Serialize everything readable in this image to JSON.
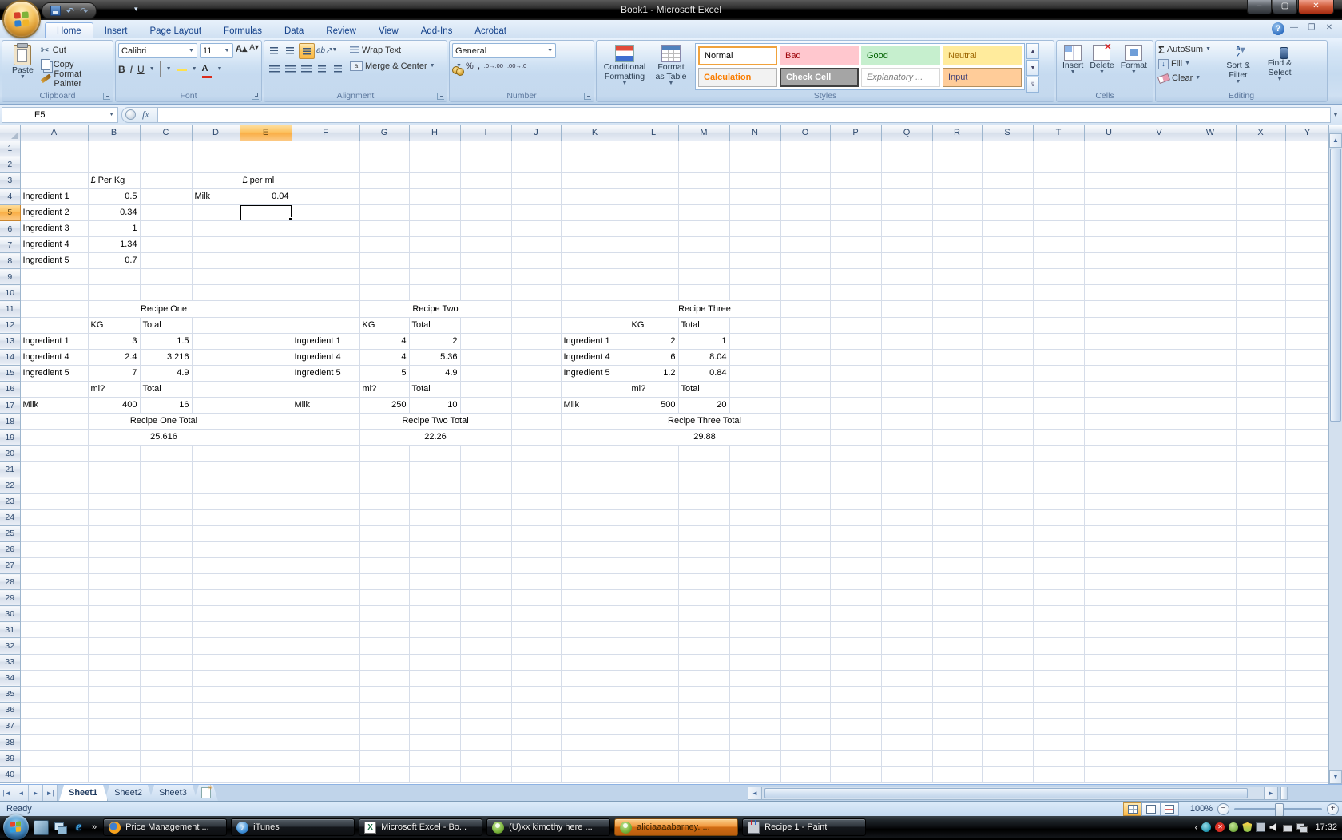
{
  "window": {
    "title": "Book1 - Microsoft Excel"
  },
  "ribbon": {
    "tabs": [
      {
        "label": "Home",
        "active": true
      },
      {
        "label": "Insert"
      },
      {
        "label": "Page Layout"
      },
      {
        "label": "Formulas"
      },
      {
        "label": "Data"
      },
      {
        "label": "Review"
      },
      {
        "label": "View"
      },
      {
        "label": "Add-Ins"
      },
      {
        "label": "Acrobat"
      }
    ],
    "clipboard": {
      "label": "Clipboard",
      "paste": "Paste",
      "cut": "Cut",
      "copy": "Copy",
      "format_painter": "Format Painter"
    },
    "font": {
      "label": "Font",
      "family": "Calibri",
      "size": "11",
      "bold": "B",
      "italic": "I",
      "underline": "U",
      "fontcolor": "A"
    },
    "alignment": {
      "label": "Alignment",
      "wrap_text": "Wrap Text",
      "merge_center": "Merge & Center"
    },
    "number": {
      "label": "Number",
      "format": "General",
      "percent": "%",
      "comma": ",",
      "inc_dec": ".0→.00",
      "dec_dec": ".00→.0"
    },
    "styles": {
      "label": "Styles",
      "conditional_1": "Conditional",
      "conditional_2": "Formatting",
      "format_table_1": "Format",
      "format_table_2": "as Table",
      "gallery": [
        {
          "label": "Normal"
        },
        {
          "label": "Bad"
        },
        {
          "label": "Good"
        },
        {
          "label": "Neutral"
        },
        {
          "label": "Calculation"
        },
        {
          "label": "Check Cell"
        },
        {
          "label": "Explanatory ..."
        },
        {
          "label": "Input"
        }
      ]
    },
    "cells": {
      "label": "Cells",
      "insert": "Insert",
      "delete": "Delete",
      "format": "Format"
    },
    "editing": {
      "label": "Editing",
      "autosum": "AutoSum",
      "fill": "Fill",
      "clear": "Clear",
      "sort_1": "Sort &",
      "sort_2": "Filter",
      "find_1": "Find &",
      "find_2": "Select"
    }
  },
  "formula_bar": {
    "name_box": "E5",
    "fx": "fx",
    "formula": ""
  },
  "sheet": {
    "columns": [
      "A",
      "B",
      "C",
      "D",
      "E",
      "F",
      "G",
      "H",
      "I",
      "J",
      "K",
      "L",
      "M",
      "N",
      "O",
      "P",
      "Q",
      "R",
      "S",
      "T",
      "U",
      "V",
      "W",
      "X",
      "Y"
    ],
    "row_count": 40,
    "selected_cell": "E5",
    "selected_col": "E",
    "selected_row": 5,
    "cells": {
      "B3": "£ Per Kg",
      "E3": "£ per ml",
      "A4": "Ingredient 1",
      "B4": "0.5",
      "D4": "Milk",
      "E4": "0.04",
      "A5": "Ingredient 2",
      "B5": "0.34",
      "A6": "Ingredient 3",
      "B6": "1",
      "A7": "Ingredient 4",
      "B7": "1.34",
      "A8": "Ingredient 5",
      "B8": "0.7",
      "B12": "KG",
      "C12": "Total",
      "G12": "KG",
      "H12": "Total",
      "L12": "KG",
      "M12": "Total",
      "A13": "Ingredient 1",
      "B13": "3",
      "C13": "1.5",
      "F13": "Ingredient 1",
      "G13": "4",
      "H13": "2",
      "K13": "Ingredient 1",
      "L13": "2",
      "M13": "1",
      "A14": "Ingredient 4",
      "B14": "2.4",
      "C14": "3.216",
      "F14": "Ingredient 4",
      "G14": "4",
      "H14": "5.36",
      "K14": "Ingredient 4",
      "L14": "6",
      "M14": "8.04",
      "A15": "Ingredient 5",
      "B15": "7",
      "C15": "4.9",
      "F15": "Ingredient 5",
      "G15": "5",
      "H15": "4.9",
      "K15": "Ingredient 5",
      "L15": "1.2",
      "M15": "0.84",
      "B16": "ml?",
      "C16": "Total",
      "G16": "ml?",
      "H16": "Total",
      "L16": "ml?",
      "M16": "Total",
      "A17": "Milk",
      "B17": "400",
      "C17": "16",
      "F17": "Milk",
      "G17": "250",
      "H17": "10",
      "K17": "Milk",
      "L17": "500",
      "M17": "20"
    },
    "merges": [
      {
        "row": 11,
        "from": "B",
        "to": "D",
        "value": "Recipe One"
      },
      {
        "row": 11,
        "from": "G",
        "to": "I",
        "value": "Recipe Two"
      },
      {
        "row": 11,
        "from": "L",
        "to": "N",
        "value": "Recipe Three"
      },
      {
        "row": 18,
        "from": "B",
        "to": "D",
        "value": "Recipe One Total"
      },
      {
        "row": 18,
        "from": "G",
        "to": "I",
        "value": "Recipe Two Total"
      },
      {
        "row": 18,
        "from": "L",
        "to": "N",
        "value": "Recipe Three Total"
      },
      {
        "row": 19,
        "from": "B",
        "to": "D",
        "value": "25.616"
      },
      {
        "row": 19,
        "from": "G",
        "to": "I",
        "value": "22.26"
      },
      {
        "row": 19,
        "from": "L",
        "to": "N",
        "value": "29.88"
      }
    ]
  },
  "sheet_tabs": {
    "tabs": [
      {
        "label": "Sheet1",
        "active": true
      },
      {
        "label": "Sheet2"
      },
      {
        "label": "Sheet3"
      }
    ]
  },
  "status_bar": {
    "mode": "Ready",
    "zoom": "100%"
  },
  "taskbar": {
    "buttons": [
      {
        "label": "Price Management ...",
        "icon": "firefox"
      },
      {
        "label": "iTunes",
        "icon": "itunes"
      },
      {
        "label": "Microsoft Excel - Bo...",
        "icon": "excel"
      },
      {
        "label": "(U)xx kimothy  here ...",
        "icon": "messenger"
      },
      {
        "label": "aliciaaaabarney.      ...",
        "icon": "messenger",
        "alert": true
      },
      {
        "label": "Recipe 1 - Paint",
        "icon": "paint"
      }
    ],
    "clock": "17:32"
  }
}
